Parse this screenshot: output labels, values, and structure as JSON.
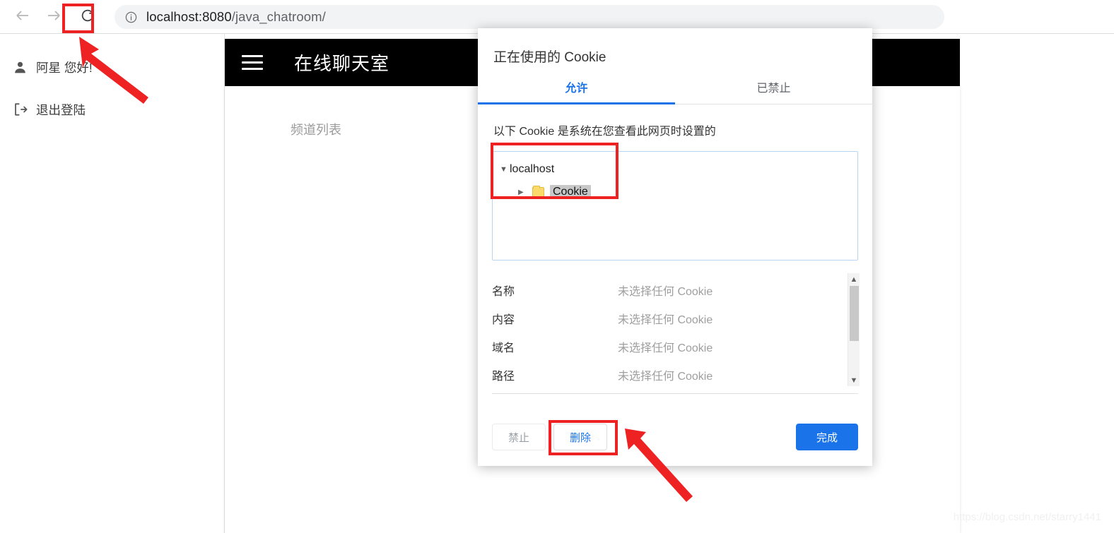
{
  "browser": {
    "back_icon": "arrow-left-icon",
    "forward_icon": "arrow-right-icon",
    "reload_icon": "reload-icon",
    "info_icon": "site-info-icon",
    "url_host": "localhost:8080",
    "url_path": "/java_chatroom/",
    "url_full": "localhost:8080/java_chatroom/"
  },
  "sidebar": {
    "items": [
      {
        "icon": "user-icon",
        "label": "阿星 您好!"
      },
      {
        "icon": "logout-icon",
        "label": "退出登陆"
      }
    ]
  },
  "app": {
    "menu_icon": "hamburger-menu-icon",
    "title": "在线聊天室",
    "channel_list_label": "频道列表"
  },
  "dialog": {
    "title": "正在使用的 Cookie",
    "tabs": [
      {
        "label": "允许",
        "active": true
      },
      {
        "label": "已禁止",
        "active": false
      }
    ],
    "description": "以下 Cookie 是系统在您查看此网页时设置的",
    "tree": {
      "root": {
        "label": "localhost",
        "expander": "▼"
      },
      "child": {
        "label": "Cookie",
        "expander": "▶",
        "icon": "folder-icon",
        "selected": true
      }
    },
    "details": [
      {
        "key": "名称",
        "value": "未选择任何 Cookie"
      },
      {
        "key": "内容",
        "value": "未选择任何 Cookie"
      },
      {
        "key": "域名",
        "value": "未选择任何 Cookie"
      },
      {
        "key": "路径",
        "value": "未选择任何 Cookie"
      }
    ],
    "scrollbar": {
      "up_icon": "chevron-up-icon",
      "down_icon": "chevron-down-icon"
    },
    "buttons": {
      "block": "禁止",
      "delete": "删除",
      "done": "完成"
    }
  },
  "annotations": {
    "highlight_color": "#ee2222",
    "targets": [
      "reload-button",
      "cookie-tree",
      "delete-button"
    ]
  },
  "watermark": "https://blog.csdn.net/starry1441"
}
